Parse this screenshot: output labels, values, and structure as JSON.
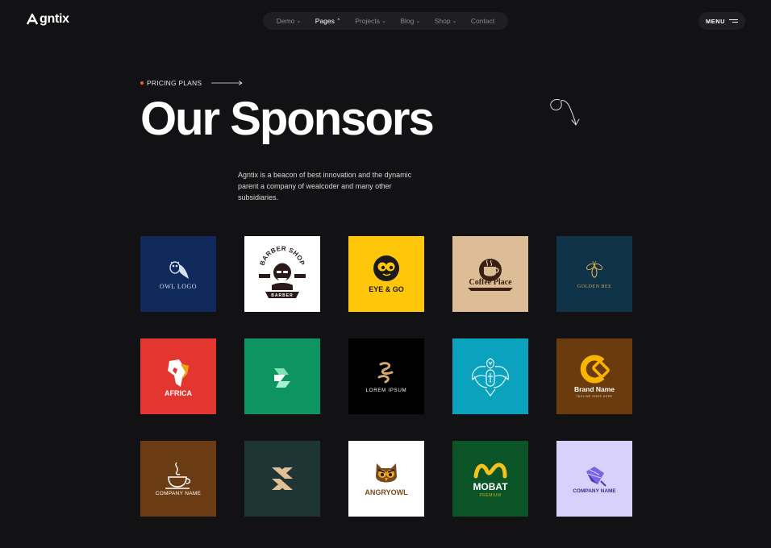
{
  "brand": {
    "name": "Agntix"
  },
  "nav": {
    "items": [
      {
        "label": "Demo",
        "chevron": "chevron-down"
      },
      {
        "label": "Pages",
        "chevron": "chevron-up"
      },
      {
        "label": "Projects",
        "chevron": "chevron-down"
      },
      {
        "label": "Blog",
        "chevron": "chevron-down"
      },
      {
        "label": "Shop",
        "chevron": "chevron-down"
      },
      {
        "label": "Contact",
        "chevron": ""
      }
    ],
    "active": "Pages",
    "menu_label": "MENU"
  },
  "hero": {
    "eyebrow": "PRICING PLANS",
    "title": "Our Sponsors",
    "description": "Agntix is a beacon of best innovation and the dynamic parent a company of wealcoder and many other subsidiaries."
  },
  "colors": {
    "accent": "#ff5a1f",
    "background": "#121214"
  },
  "sponsors": [
    {
      "name": "OWL LOGO",
      "bg": "#0f2a5a",
      "icon": "owl-icon"
    },
    {
      "name": "BARBER SHOP",
      "sub": "BARBER",
      "bg": "#ffffff",
      "icon": "barber-icon"
    },
    {
      "name": "EYE & GO",
      "bg": "#ffc60a",
      "icon": "eyes-icon"
    },
    {
      "name": "Coffee Place",
      "bg": "#dcbd95",
      "icon": "coffee-cup-icon"
    },
    {
      "name": "GOLDEN BEE",
      "bg": "#0e3247",
      "icon": "bee-icon"
    },
    {
      "name": "AFRICA",
      "bg": "#e2362f",
      "icon": "africa-icon"
    },
    {
      "name": "",
      "bg": "#0d9460",
      "icon": "arrow-play-icon"
    },
    {
      "name": "LOREM IPSUM",
      "bg": "#000000",
      "icon": "wave-icon"
    },
    {
      "name": "",
      "bg": "#0aa2bd",
      "icon": "eagle-icon"
    },
    {
      "name": "Brand Name",
      "sub": "TAGLINE GOES HERE",
      "bg": "#6b3a0d",
      "icon": "ring-icon"
    },
    {
      "name": "COMPANY NAME",
      "bg": "#6b3b13",
      "icon": "coffee-steam-icon"
    },
    {
      "name": "",
      "bg": "#1f3535",
      "icon": "x-stripes-icon"
    },
    {
      "name": "ANGRYOWL",
      "bg": "#ffffff",
      "icon": "angry-owl-icon"
    },
    {
      "name": "MOBAT",
      "sub": "PREMIUM",
      "bg": "#0b5428",
      "icon": "m-wave-icon"
    },
    {
      "name": "COMPANY NAME",
      "bg": "#d8d1fb",
      "icon": "crystal-icon"
    }
  ]
}
